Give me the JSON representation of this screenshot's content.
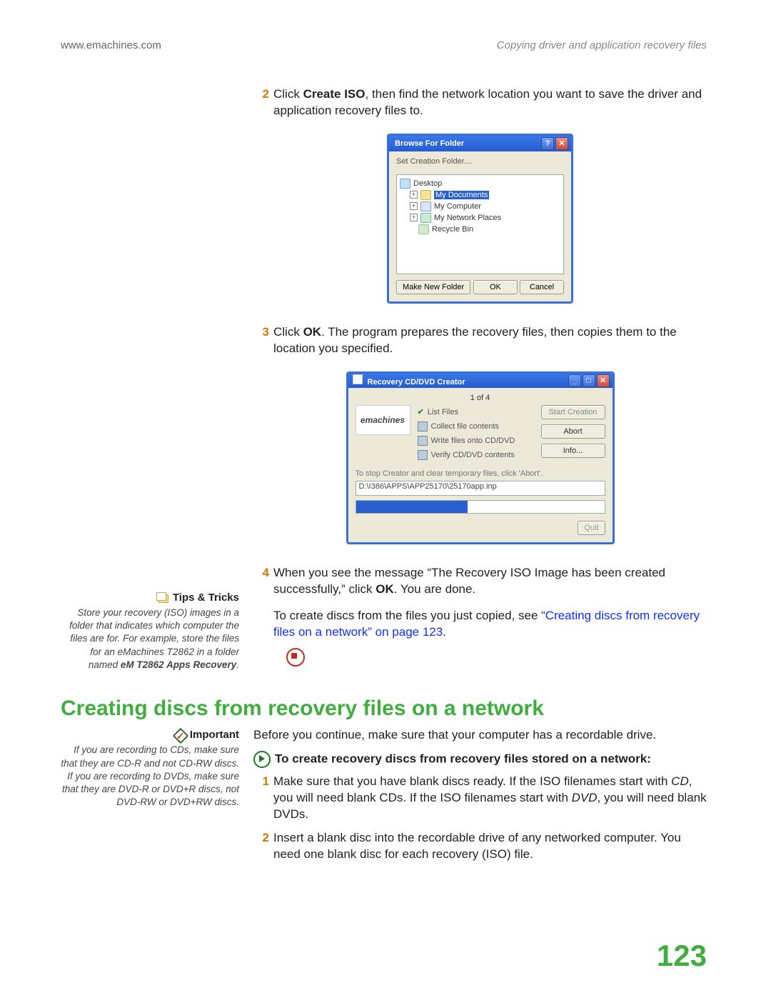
{
  "header": {
    "left": "www.emachines.com",
    "right": "Copying driver and application recovery files"
  },
  "steps_a": [
    {
      "num": "2",
      "html": "Click <b>Create ISO</b>, then find the network location you want to save the driver and application recovery files to."
    },
    {
      "num": "3",
      "html": "Click <b>OK</b>. The program prepares the recovery files, then copies them to the location you specified."
    },
    {
      "num": "4",
      "html": "When you see the message “The Recovery ISO Image has been created successfully,” click <b>OK</b>. You are done."
    }
  ],
  "bff": {
    "title": "Browse For Folder",
    "prompt": "Set Creation Folder....",
    "nodes": {
      "desktop": "Desktop",
      "mydocs": "My Documents",
      "mycomp": "My Computer",
      "netplaces": "My Network Places",
      "recycle": "Recycle Bin"
    },
    "buttons": {
      "new": "Make New Folder",
      "ok": "OK",
      "cancel": "Cancel"
    }
  },
  "rc": {
    "title": "Recovery CD/DVD Creator",
    "count": "1 of 4",
    "logo": "emachines",
    "steps": {
      "list": "List Files",
      "collect": "Collect file contents",
      "write": "Write files onto CD/DVD",
      "verify": "Verify CD/DVD contents"
    },
    "buttons": {
      "start": "Start Creation",
      "abort": "Abort",
      "info": "Info...",
      "quit": "Quit"
    },
    "hint": "To stop Creator and clear temporary files, click 'Abort'.",
    "path": "D:\\I386\\APPS\\APP25170\\25170app.inp"
  },
  "xref": {
    "lead": "To create discs from the files you just copied, see ",
    "link": "“Creating discs from recovery files on a network” on page 123",
    "tail": "."
  },
  "tips": {
    "title": "Tips & Tricks",
    "body": "Store your recovery (ISO) images in a folder that indicates which computer the files are for. For example, store the files for an eMachines T2862 in a folder named ",
    "em": "eM T2862 Apps Recovery",
    "tail": "."
  },
  "heading": "Creating discs from recovery files on a network",
  "important": {
    "title": "Important",
    "body": "If you are recording to CDs, make sure that they are CD-R and not CD-RW discs. If you are recording to DVDs, make sure that they are DVD-R or DVD+R discs, not DVD-RW or DVD+RW discs."
  },
  "section2": {
    "intro": "Before you continue, make sure that your computer has a recordable drive.",
    "subhead": "To create recovery discs from recovery files stored on a network:",
    "steps": [
      {
        "num": "1",
        "html": "Make sure that you have blank discs ready. If the ISO filenames start with <em>CD</em>, you will need blank CDs. If the ISO filenames start with <em>DVD</em>, you will need blank DVDs."
      },
      {
        "num": "2",
        "html": "Insert a blank disc into the recordable drive of any networked computer. You need one blank disc for each recovery (ISO) file."
      }
    ]
  },
  "page_number": "123"
}
